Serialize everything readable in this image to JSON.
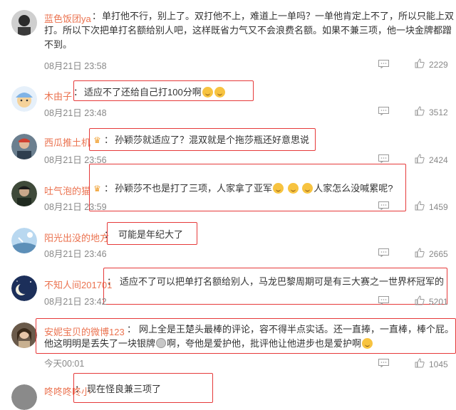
{
  "colors": {
    "username": "#eb7350",
    "highlight_box": "#e63a3a",
    "meta": "#888888"
  },
  "comments": [
    {
      "username": "蓝色饭团ya",
      "separator": "：",
      "text": "单打他不行，别上了。双打他不上，难道上一单吗？一单他肯定上不了，所以只能上双打。所以下次把单打名额给别人吧，这样既省力气又不会浪费名额。如果不兼三项，他一块金牌都蹭不到。",
      "time": "08月21日 23:58",
      "likes": "2229"
    },
    {
      "username": "木由子",
      "separator": "：",
      "text": "适应不了还给自己打100分啊",
      "time": "08月21日 23:48",
      "likes": "3512"
    },
    {
      "username": "西瓜推土机",
      "separator": "：",
      "text": "孙颖莎就适应了？混双就是个拖莎瓶还好意思说",
      "time": "08月21日 23:56",
      "likes": "2424"
    },
    {
      "username": "吐气泡的猫",
      "separator": "：",
      "text_a": "孙颖莎不也是打了三项，人家拿了亚军",
      "text_b": "人家怎么没喊累呢?",
      "time": "08月21日 23:59",
      "likes": "1459"
    },
    {
      "username": "阳光出没的地方",
      "separator": "：",
      "text": "可能是年纪大了",
      "time": "08月21日 23:46",
      "likes": "2665"
    },
    {
      "username": "不知人间201701",
      "separator": "：",
      "text": "适应不了可以把单打名额给别人，马龙巴黎周期可是有三大赛之一世界杯冠军的",
      "time": "08月21日 23:42",
      "likes": "5201"
    },
    {
      "username": "安妮宝贝的微博123",
      "separator": "：",
      "text_a": "网上全是王楚头最棒的评论，容不得半点实话。还一直捧，一直棒，棒个屁。他这明明是丢失了一块银牌",
      "text_b": "啊，夸他是爱护他，批评他让他进步也是爱护啊",
      "time": "今天00:01",
      "likes": "1045"
    },
    {
      "username": "咚咚咚咚小",
      "separator": "：",
      "text": "现在怪良兼三项了"
    }
  ]
}
